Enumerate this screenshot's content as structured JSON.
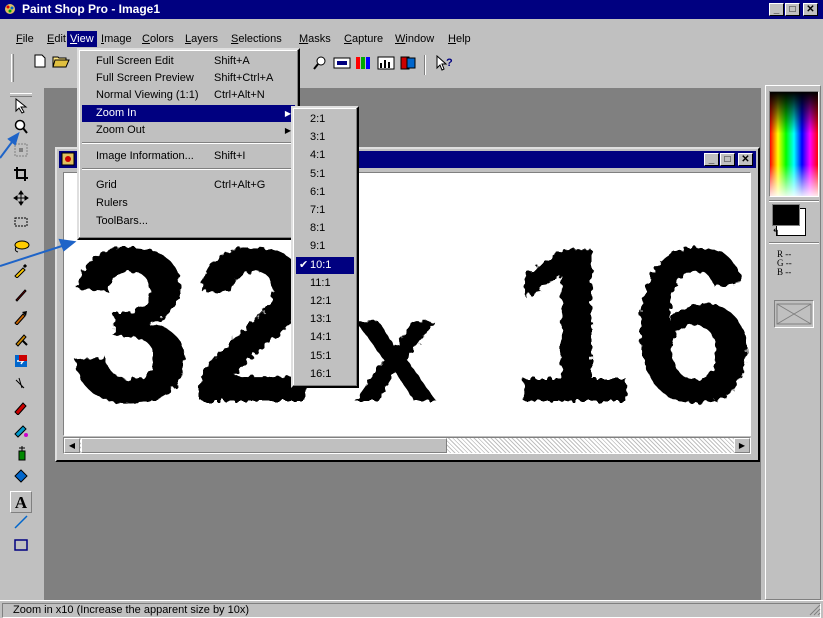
{
  "app": {
    "title": "Paint Shop Pro - Image1"
  },
  "menubar": [
    "File",
    "Edit",
    "View",
    "Image",
    "Colors",
    "Layers",
    "Selections",
    "Masks",
    "Capture",
    "Window",
    "Help"
  ],
  "view_menu": {
    "items": [
      {
        "label": "Full Screen Edit",
        "shortcut": "Shift+A"
      },
      {
        "label": "Full Screen Preview",
        "shortcut": "Shift+Ctrl+A"
      },
      {
        "label": "Normal Viewing (1:1)",
        "shortcut": "Ctrl+Alt+N"
      },
      {
        "label": "Zoom In",
        "shortcut": ""
      },
      {
        "label": "Zoom Out",
        "shortcut": ""
      },
      {
        "label": "Image Information...",
        "shortcut": "Shift+I"
      },
      {
        "label": "Grid",
        "shortcut": "Ctrl+Alt+G"
      },
      {
        "label": "Rulers",
        "shortcut": ""
      },
      {
        "label": "ToolBars...",
        "shortcut": ""
      }
    ]
  },
  "zoom_submenu": {
    "items": [
      "2:1",
      "3:1",
      "4:1",
      "5:1",
      "6:1",
      "7:1",
      "8:1",
      "9:1",
      "10:1",
      "11:1",
      "12:1",
      "13:1",
      "14:1",
      "15:1",
      "16:1"
    ],
    "selected": "10:1",
    "check_mark": "✔"
  },
  "canvas": {
    "text_left": "32",
    "text_mid": "x",
    "text_right": "16"
  },
  "color_palette": {
    "r_label": "R --",
    "g_label": "G --",
    "b_label": "B --",
    "foreground": "#000000",
    "background": "#ffffff"
  },
  "status": {
    "text": "Zoom in x10 (Increase the apparent size by 10x)"
  },
  "window_buttons": {
    "minimize": "_",
    "maximize": "□",
    "close": "✕"
  },
  "colors": {
    "titlebar": "#000080",
    "face": "#c0c0c0",
    "workspace": "#808080",
    "callout": "#1e64c8"
  },
  "icons": [
    "new-file-icon",
    "open-folder-icon",
    "arrow-tool-icon",
    "zoom-tool-icon",
    "deformation-icon",
    "crop-icon",
    "mover-icon",
    "selection-icon",
    "lasso-icon",
    "color-picker-icon",
    "paintbrush-icon",
    "clone-brush-icon",
    "color-replacer-icon",
    "retouch-icon",
    "scratch-remover-icon",
    "eraser-icon",
    "picture-tube-icon",
    "airbrush-icon",
    "flood-fill-icon",
    "text-tool-icon",
    "line-tool-icon",
    "shape-tool-icon",
    "help-pointer-icon"
  ]
}
